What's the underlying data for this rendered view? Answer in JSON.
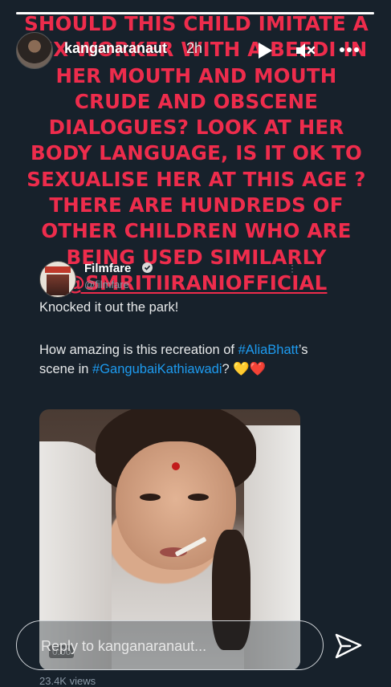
{
  "story": {
    "progress_fraction": 1.0,
    "username": "kanganaranaut",
    "time_ago": "2h",
    "headline_text": "SHOULD THIS CHILD IMITATE A SEX WORKER WITH A BEEDI IN HER MOUTH AND MOUTH CRUDE AND OBSCENE DIALOGUES?  LOOK AT HER BODY LANGUAGE, IS IT OK TO SEXUALISE HER AT THIS AGE ? THERE ARE HUNDREDS OF OTHER CHILDREN WHO ARE BEING USED SIMILARLY ",
    "headline_mention": "@SMRITIIRANIOFFICIAL",
    "headline_color": "#ee2c4c",
    "icons": {
      "play": "play-icon",
      "mute": "speaker-muted-icon",
      "more": "more-horizontal-icon"
    }
  },
  "tweet": {
    "author_name": "Filmfare",
    "author_handle": "@filmfare",
    "verified": true,
    "line1": "Knocked it out the park!",
    "line2_a": "How amazing is this recreation of ",
    "hashtag1": "#AliaBhatt",
    "line2_b": "’s scene in ",
    "hashtag2": "#GangubaiKathiawadi",
    "line2_c": "? ",
    "emoji": "💛❤️",
    "media_timestamp": "0:00",
    "views": "23.4K views",
    "hashtag_color": "#1d9bf0"
  },
  "reply": {
    "placeholder": "Reply to kanganaranaut...",
    "send_icon": "send-paper-plane-icon"
  }
}
